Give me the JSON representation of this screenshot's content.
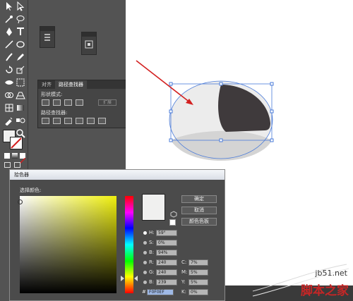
{
  "pathfinder": {
    "tabs": [
      "对齐",
      "路径查找器"
    ],
    "shape_modes_label": "形状模式:",
    "expand_label": "扩展",
    "pathfinders_label": "路径查找器:"
  },
  "color_picker": {
    "title": "拾色器",
    "select_color_label": "选择颜色:",
    "buttons": {
      "ok": "确定",
      "cancel": "取消",
      "swatches": "颜色色板"
    },
    "hsb": [
      {
        "key": "H:",
        "value": "59°",
        "selected": true
      },
      {
        "key": "S:",
        "value": "0%",
        "selected": false
      },
      {
        "key": "B:",
        "value": "94%",
        "selected": false
      }
    ],
    "rgb": [
      {
        "key": "R:",
        "value": "240"
      },
      {
        "key": "G:",
        "value": "240"
      },
      {
        "key": "B:",
        "value": "239"
      }
    ],
    "cmyk": [
      {
        "key": "C:",
        "value": "7%"
      },
      {
        "key": "M:",
        "value": "5%"
      },
      {
        "key": "Y:",
        "value": "5%"
      },
      {
        "key": "K:",
        "value": "0%"
      }
    ],
    "hex_label": "#",
    "hex_value": "F0F0EF",
    "current_color": "#f0f0ef",
    "hue_color": "#f0f00e"
  },
  "watermark": {
    "site": "jb51.net",
    "name": "脚本之家"
  },
  "colors": {
    "annotation_arrow": "#d32020",
    "selection": "#4a7bd9",
    "dark_shape": "#3f3a3c",
    "light_ellipse": "#ececec",
    "ellipse_shade": "#d4d4d4"
  }
}
